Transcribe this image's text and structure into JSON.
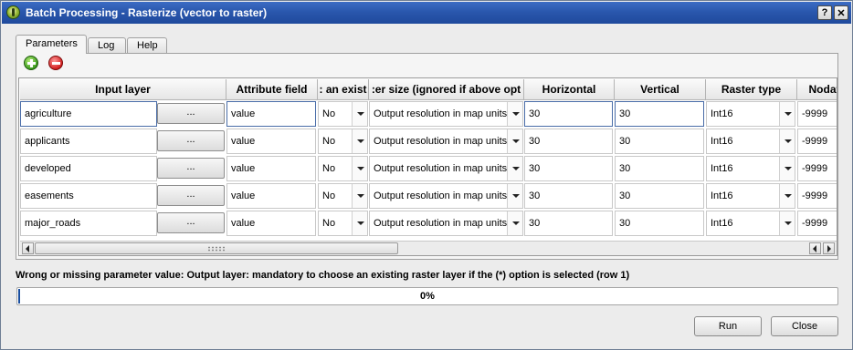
{
  "window": {
    "title": "Batch Processing - Rasterize (vector to raster)",
    "help_label": "?",
    "close_label": "✕"
  },
  "tabs": [
    {
      "label": "Parameters",
      "active": true
    },
    {
      "label": "Log",
      "active": false
    },
    {
      "label": "Help",
      "active": false
    }
  ],
  "toolbar": {
    "add_icon": "add-row-icon",
    "remove_icon": "remove-row-icon"
  },
  "table": {
    "columns": [
      "Input layer",
      "Attribute field",
      ": an exist",
      ":er size (ignored if above opt",
      "Horizontal",
      "Vertical",
      "Raster type",
      "Nodat"
    ],
    "browse_label": "...",
    "rows": [
      {
        "layer": "agriculture",
        "field": "value",
        "overwrite": "No",
        "size_mode": "Output resolution in map units",
        "horizontal": "30",
        "vertical": "30",
        "raster_type": "Int16",
        "nodata": "-9999"
      },
      {
        "layer": "applicants",
        "field": "value",
        "overwrite": "No",
        "size_mode": "Output resolution in map units",
        "horizontal": "30",
        "vertical": "30",
        "raster_type": "Int16",
        "nodata": "-9999"
      },
      {
        "layer": "developed",
        "field": "value",
        "overwrite": "No",
        "size_mode": "Output resolution in map units",
        "horizontal": "30",
        "vertical": "30",
        "raster_type": "Int16",
        "nodata": "-9999"
      },
      {
        "layer": "easements",
        "field": "value",
        "overwrite": "No",
        "size_mode": "Output resolution in map units",
        "horizontal": "30",
        "vertical": "30",
        "raster_type": "Int16",
        "nodata": "-9999"
      },
      {
        "layer": "major_roads",
        "field": "value",
        "overwrite": "No",
        "size_mode": "Output resolution in map units",
        "horizontal": "30",
        "vertical": "30",
        "raster_type": "Int16",
        "nodata": "-9999"
      }
    ]
  },
  "status": {
    "message": "Wrong or missing parameter value: Output layer: mandatory to choose an existing raster layer if the (*) option is selected (row 1)"
  },
  "progress": {
    "value": 0,
    "label": "0%"
  },
  "buttons": {
    "run": "Run",
    "close": "Close"
  }
}
